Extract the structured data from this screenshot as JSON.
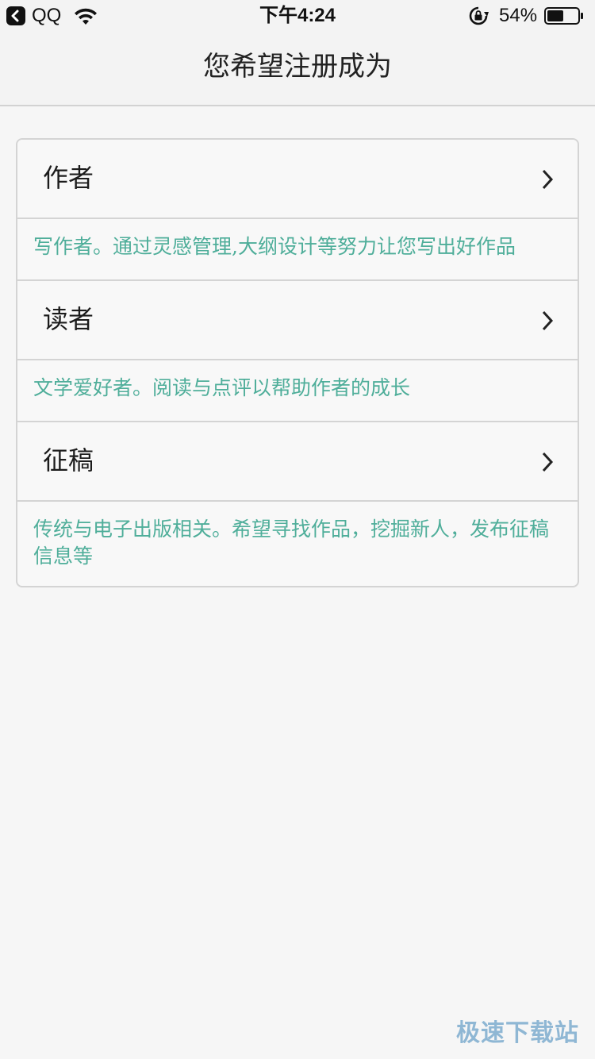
{
  "status_bar": {
    "app_name": "QQ",
    "time": "下午4:24",
    "battery_percent": "54%",
    "battery_level": 0.54,
    "back_icon": "back-arrow-icon",
    "wifi_icon": "wifi-icon",
    "lock_icon": "rotation-lock-icon",
    "battery_icon": "battery-icon"
  },
  "nav": {
    "title": "您希望注册成为"
  },
  "roles": [
    {
      "title": "作者",
      "description": "写作者。通过灵感管理,大纲设计等努力让您写出好作品"
    },
    {
      "title": "读者",
      "description": "文学爱好者。阅读与点评以帮助作者的成长"
    },
    {
      "title": "征稿",
      "description": "传统与电子出版相关。希望寻找作品，挖掘新人，发布征稿信息等"
    }
  ],
  "watermark": "极速下载站",
  "colors": {
    "description_text": "#4fae9a",
    "background": "#f6f6f6",
    "border": "#d4d4d4"
  }
}
